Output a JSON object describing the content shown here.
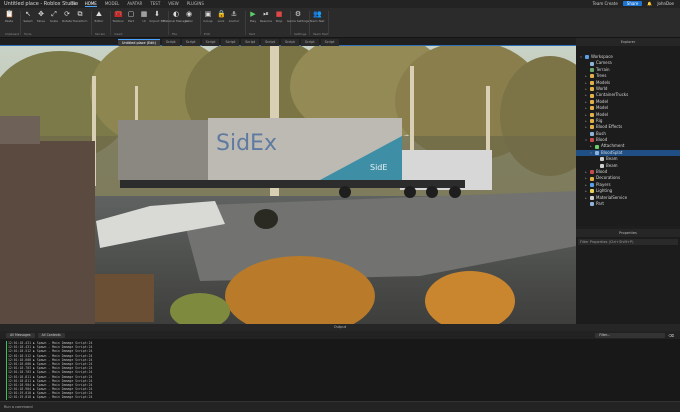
{
  "window": {
    "title": "Untitled place - Roblox Studio"
  },
  "menu": [
    "File",
    "HOME",
    "MODEL",
    "AVATAR",
    "TEST",
    "VIEW",
    "PLUGINS"
  ],
  "menu_active": 1,
  "top_right": {
    "share": "Share",
    "user": "Team Create",
    "user2": "JohnDoe"
  },
  "ribbon": {
    "groups": [
      {
        "label": "Clipboard",
        "buttons": [
          "Paste"
        ]
      },
      {
        "label": "Tools",
        "buttons": [
          "Select",
          "Move",
          "Scale",
          "Rotate",
          "Transform"
        ]
      },
      {
        "label": "Terrain",
        "buttons": [
          "Editor"
        ]
      },
      {
        "label": "Insert",
        "buttons": [
          "Toolbox",
          "Part",
          "UI",
          "Import 3D"
        ]
      },
      {
        "label": "File",
        "buttons": [
          "Material Manager",
          "Color"
        ]
      },
      {
        "label": "Edit",
        "buttons": [
          "Group",
          "Lock",
          "Anchor"
        ]
      },
      {
        "label": "Test",
        "buttons": [
          "Play",
          "Resume",
          "Stop"
        ]
      },
      {
        "label": "Settings",
        "buttons": [
          "Game Settings"
        ]
      },
      {
        "label": "Team Test",
        "buttons": [
          "Team Test"
        ]
      }
    ]
  },
  "left_panel": {
    "title": "Properties"
  },
  "tabs": [
    "Untitled place (Edit)",
    "Script",
    "Script",
    "Script",
    "Script",
    "Script",
    "Script",
    "Script",
    "Script",
    "Script"
  ],
  "tab_active": 0,
  "explorer": {
    "title": "Explorer",
    "items": [
      {
        "label": "Workspace",
        "depth": 0,
        "arrow": "▾",
        "color": "#5aa0e6"
      },
      {
        "label": "Camera",
        "depth": 1,
        "arrow": "",
        "color": "#8fb3d8"
      },
      {
        "label": "Terrain",
        "depth": 1,
        "arrow": "",
        "color": "#6ca86c"
      },
      {
        "label": "Trees",
        "depth": 1,
        "arrow": "▸",
        "color": "#e0b04a"
      },
      {
        "label": "Models",
        "depth": 1,
        "arrow": "▸",
        "color": "#e0b04a"
      },
      {
        "label": "World",
        "depth": 1,
        "arrow": "▸",
        "color": "#e0b04a"
      },
      {
        "label": "ContainerTrucks",
        "depth": 1,
        "arrow": "▸",
        "color": "#e0b04a"
      },
      {
        "label": "Model",
        "depth": 1,
        "arrow": "▸",
        "color": "#e0b04a"
      },
      {
        "label": "Model",
        "depth": 1,
        "arrow": "▸",
        "color": "#e0b04a"
      },
      {
        "label": "Model",
        "depth": 1,
        "arrow": "▸",
        "color": "#e0b04a"
      },
      {
        "label": "Rig",
        "depth": 1,
        "arrow": "▸",
        "color": "#e0b04a"
      },
      {
        "label": "Blood Effects",
        "depth": 1,
        "arrow": "▸",
        "color": "#e0b04a"
      },
      {
        "label": "Bush",
        "depth": 1,
        "arrow": "",
        "color": "#8fb3d8"
      },
      {
        "label": "Blood",
        "depth": 1,
        "arrow": "▾",
        "color": "#c94a4a"
      },
      {
        "label": "Attachment",
        "depth": 2,
        "arrow": "▸",
        "color": "#6bd06b"
      },
      {
        "label": "BloodSplat",
        "depth": 2,
        "arrow": "▾",
        "color": "#8fb3d8"
      },
      {
        "label": "Beam",
        "depth": 3,
        "arrow": "",
        "color": "#cfcfcf"
      },
      {
        "label": "Beam",
        "depth": 3,
        "arrow": "",
        "color": "#cfcfcf"
      },
      {
        "label": "Blood",
        "depth": 1,
        "arrow": "▸",
        "color": "#c94a4a"
      },
      {
        "label": "Decorations",
        "depth": 1,
        "arrow": "▸",
        "color": "#e0b04a"
      },
      {
        "label": "Players",
        "depth": 1,
        "arrow": "▸",
        "color": "#5aa0e6"
      },
      {
        "label": "Lighting",
        "depth": 1,
        "arrow": "▸",
        "color": "#e6d35a"
      },
      {
        "label": "MaterialService",
        "depth": 1,
        "arrow": "▸",
        "color": "#cfcfcf"
      },
      {
        "label": "Part",
        "depth": 1,
        "arrow": "",
        "color": "#8fb3d8"
      }
    ]
  },
  "properties": {
    "title": "Properties",
    "filter": "Filter Properties (Ctrl+Shift+P)"
  },
  "output": {
    "title": "Output",
    "buttons": [
      "All Messages",
      "All Contexts"
    ],
    "filter_placeholder": "Filter...",
    "lines": [
      "12:01:18.431  ▶  Spawn  -  Main Damage Script:24",
      "12:01:18.431  ▶  Spawn  -  Main Damage Script:24",
      "12:01:18.512  ▶  Spawn  -  Main Damage Script:24",
      "12:01:18.512  ▶  Spawn  -  Main Damage Script:24",
      "12:01:18.600  ▶  Spawn  -  Main Damage Script:24",
      "12:01:18.600  ▶  Spawn  -  Main Damage Script:24",
      "12:01:18.703  ▶  Spawn  -  Main Damage Script:24",
      "12:01:18.703  ▶  Spawn  -  Main Damage Script:24",
      "12:01:18.811  ▶  Spawn  -  Main Damage Script:24",
      "12:01:18.811  ▶  Spawn  -  Main Damage Script:24",
      "12:01:18.904  ▶  Spawn  -  Main Damage Script:24",
      "12:01:18.904  ▶  Spawn  -  Main Damage Script:24",
      "12:01:19.010  ▶  Spawn  -  Main Damage Script:24",
      "12:01:19.010  ▶  Spawn  -  Main Damage Script:24"
    ]
  },
  "command_bar": {
    "placeholder": "Run a command"
  },
  "scene": {
    "trailer_logo": "SidEx",
    "trailer_logo_small": "SidE"
  }
}
